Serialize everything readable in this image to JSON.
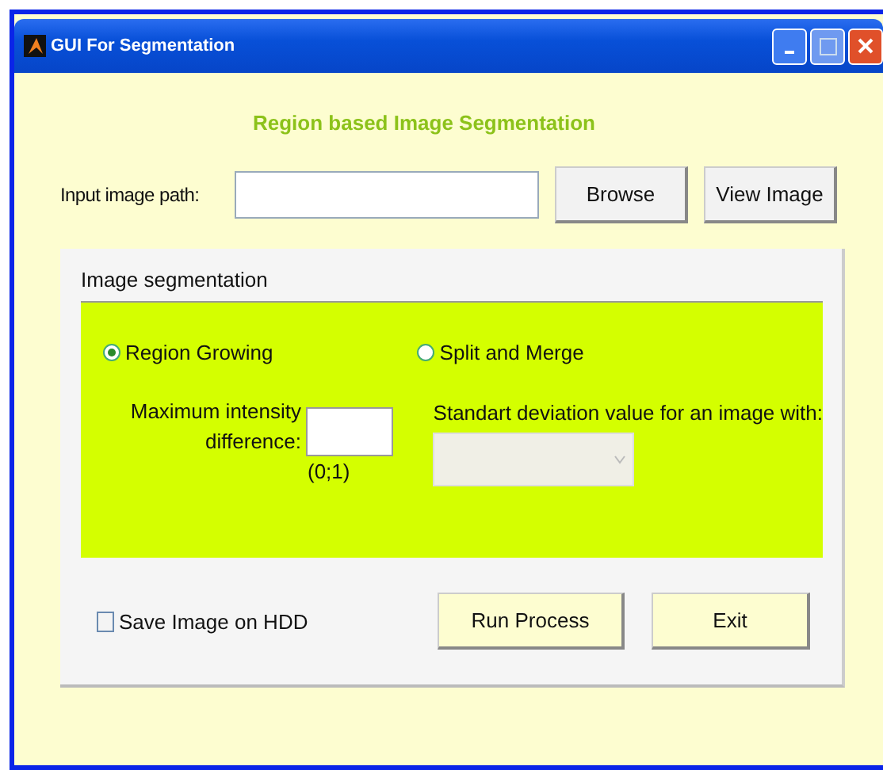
{
  "window": {
    "title": "GUI For Segmentation"
  },
  "heading": "Region based Image Segmentation",
  "input_path": {
    "label": "Input image path:"
  },
  "top_buttons": [
    "Browse",
    "View Image"
  ],
  "panel": {
    "title": "Image segmentation",
    "methods": [
      {
        "label": "Region Growing",
        "selected": true
      },
      {
        "label": "Split and Merge",
        "selected": false
      }
    ],
    "intensity": {
      "label": "Maximum intensity difference:",
      "range": "(0;1)"
    },
    "deviation": {
      "label": "Standart deviation value for an image with:",
      "disabled": true
    },
    "save": {
      "label": "Save Image on HDD",
      "checked": false
    },
    "buttons": [
      "Run Process",
      "Exit"
    ]
  }
}
